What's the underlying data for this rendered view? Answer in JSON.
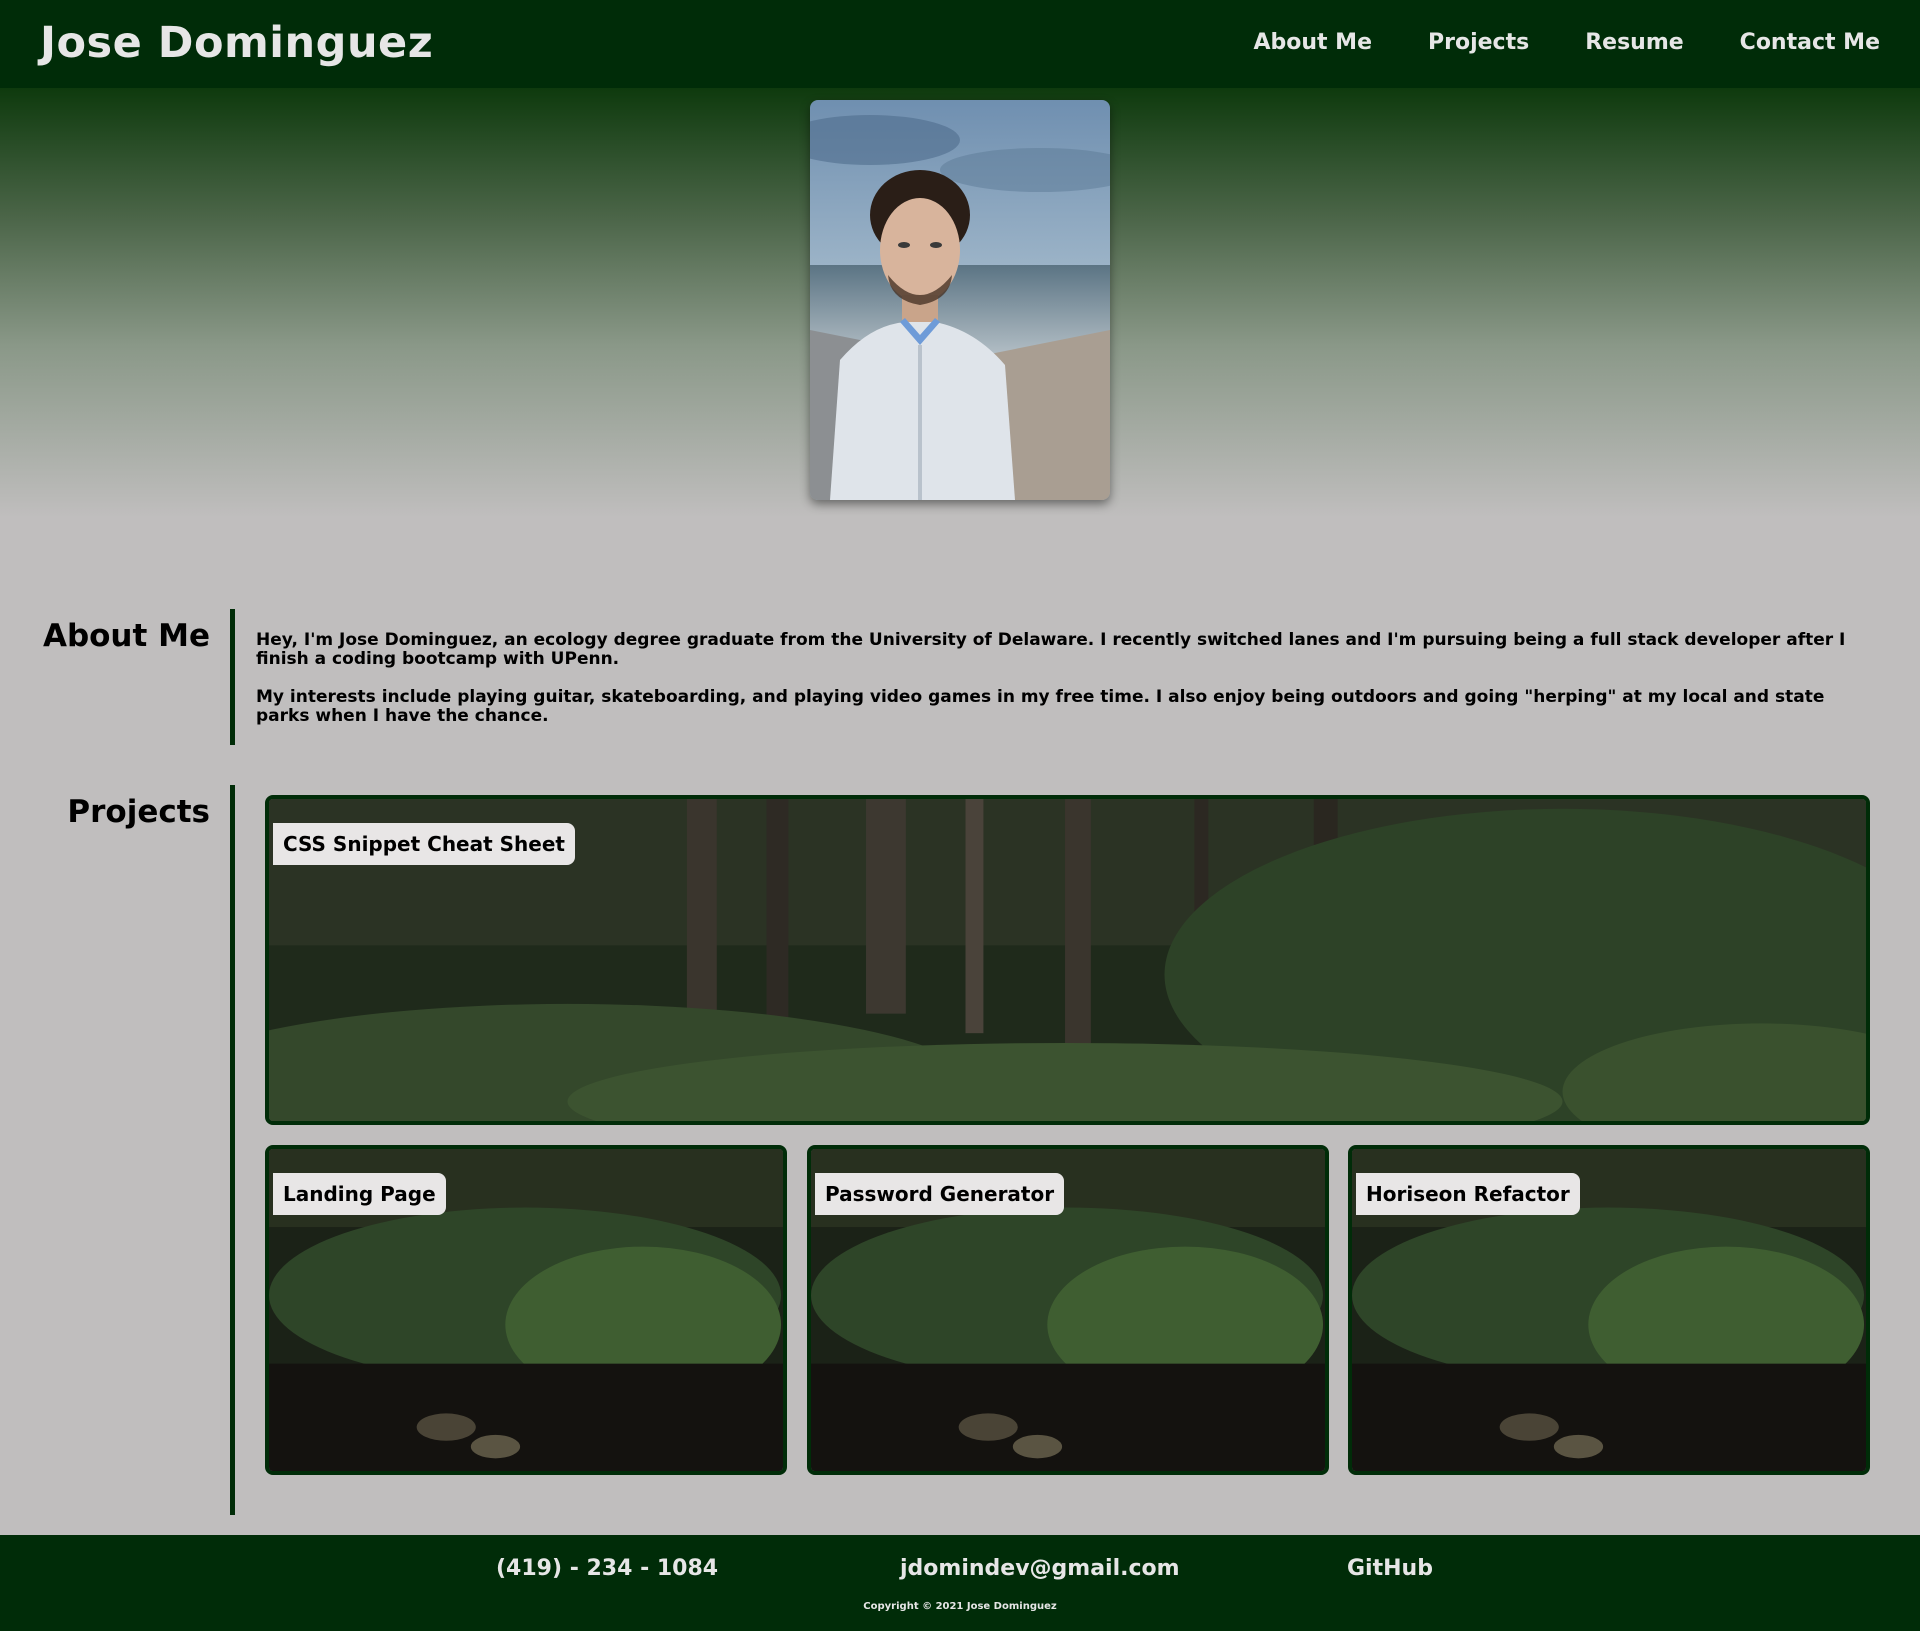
{
  "header": {
    "site_title": "Jose Dominguez",
    "nav": [
      "About Me",
      "Projects",
      "Resume",
      "Contact Me"
    ]
  },
  "hero": {
    "portrait_alt": "portrait-photo"
  },
  "about": {
    "title": "About Me",
    "paragraphs": [
      "Hey, I'm Jose Dominguez, an ecology degree graduate from the University of Delaware. I recently switched lanes and I'm pursuing being a full stack developer after I finish a coding bootcamp with UPenn.",
      "My interests include playing guitar, skateboarding, and playing video games in my free time. I also enjoy being outdoors and going \"herping\" at my local and state parks when I have the chance."
    ]
  },
  "projects": {
    "title": "Projects",
    "items": [
      {
        "label": "CSS Snippet Cheat Sheet"
      },
      {
        "label": "Landing Page"
      },
      {
        "label": "Password Generator"
      },
      {
        "label": "Horiseon Refactor"
      }
    ]
  },
  "footer": {
    "phone": "(419) - 234 - 1084",
    "email": "jdomindev@gmail.com",
    "github": "GitHub",
    "copyright": "Copyright © 2021 Jose Dominguez"
  },
  "colors": {
    "primary": "#002c08",
    "background": "#c0bebe",
    "label_bg": "#e8e6e6",
    "nav_text": "#e6e6e6"
  }
}
